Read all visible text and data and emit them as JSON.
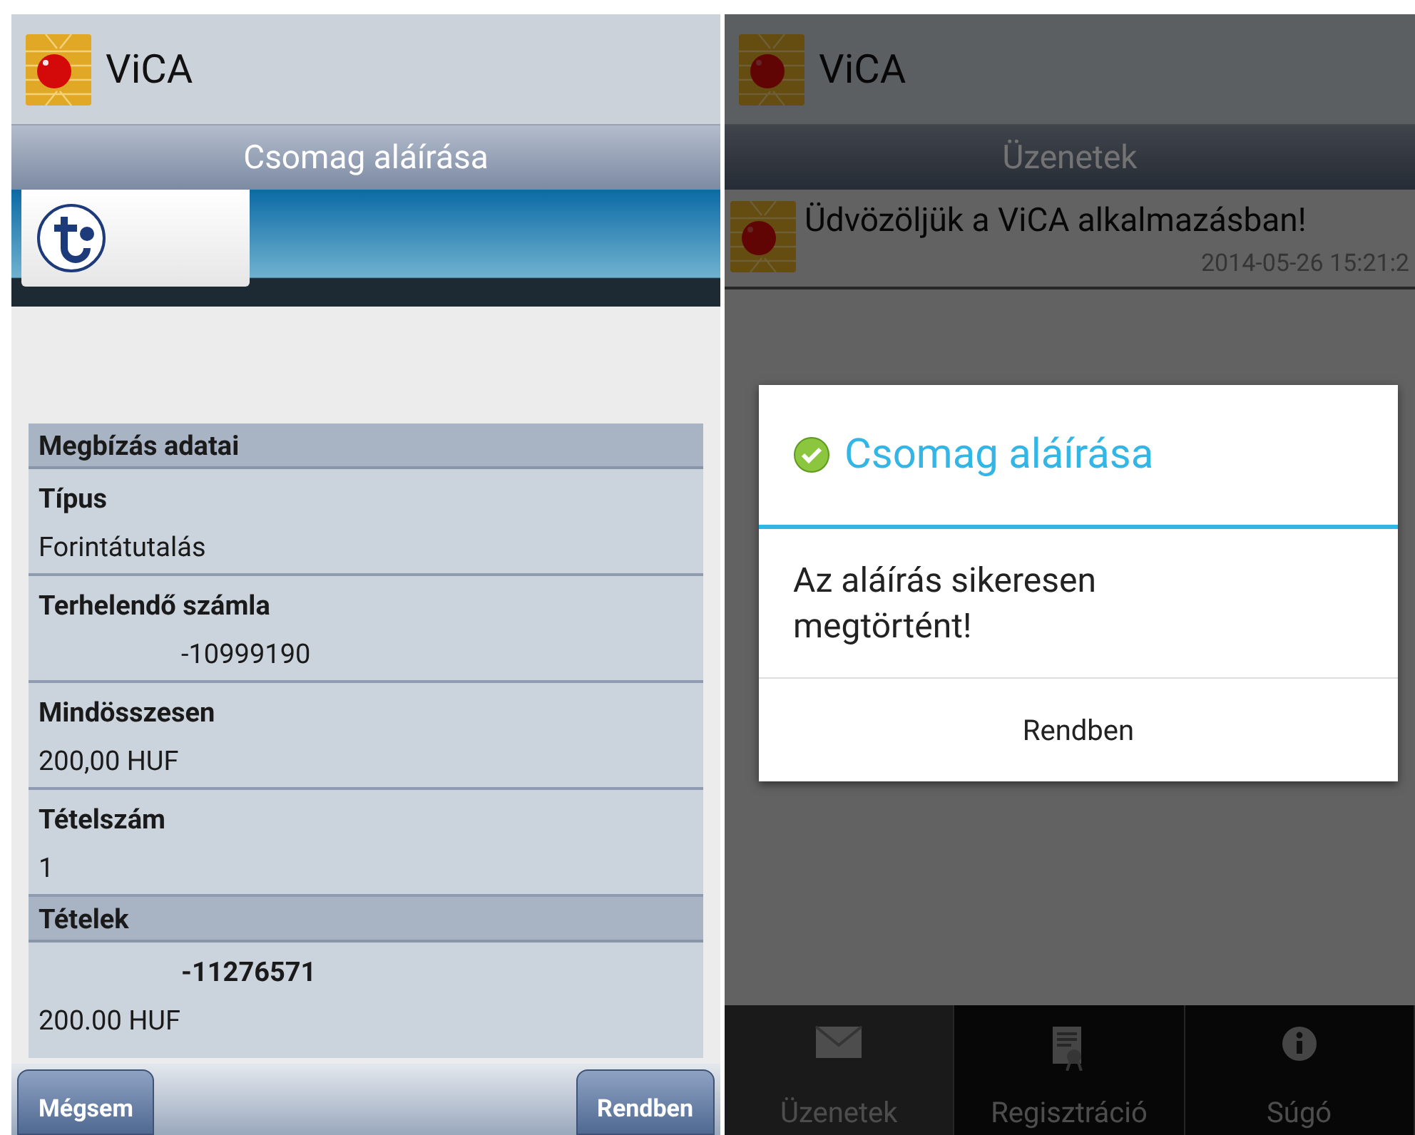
{
  "left_screen": {
    "app_title": "ViCA",
    "title_bar": "Csomag aláírása",
    "details": [
      {
        "kind": "section",
        "label": "Megbízás adatai"
      },
      {
        "kind": "field",
        "label": "Típus",
        "value": "Forintátutalás"
      },
      {
        "kind": "masked",
        "label": "Terhelendő számla",
        "value": "-10999190"
      },
      {
        "kind": "field",
        "label": "Mindösszesen",
        "value": "200,00 HUF"
      },
      {
        "kind": "field",
        "label": "Tételszám",
        "value": "1"
      },
      {
        "kind": "section",
        "label": "Tételek"
      },
      {
        "kind": "item",
        "label": "-11276571",
        "value": "200.00 HUF"
      }
    ],
    "buttons": [
      {
        "label": "Mégsem"
      },
      {
        "label": "Rendben"
      }
    ]
  },
  "right_screen": {
    "app_title": "ViCA",
    "title_bar": "Üzenetek",
    "messages": [
      {
        "text": "Üdvözöljük a ViCA alkalmazásban!",
        "time": "2014-05-26 15:21:2"
      }
    ],
    "dialog": {
      "title": "Csomag aláírása",
      "message": "Az aláírás sikeresen megtörtént!",
      "button": "Rendben"
    },
    "tabs": [
      {
        "label": "Üzenetek",
        "kind": "mail",
        "selected": true
      },
      {
        "label": "Regisztráció",
        "kind": "certificate",
        "selected": false
      },
      {
        "label": "Súgó",
        "kind": "info",
        "selected": false
      }
    ]
  }
}
